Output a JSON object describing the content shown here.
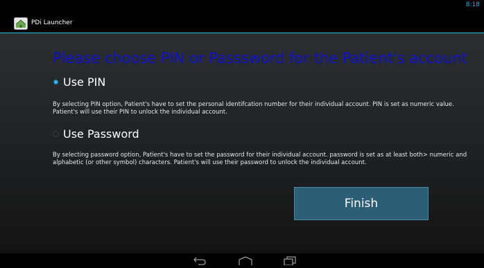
{
  "status_bar": {
    "time": "8:18"
  },
  "action_bar": {
    "title": "PDi Launcher"
  },
  "heading": "Please choose PIN or Passsword for the Patient's account",
  "options": [
    {
      "label": "Use PIN",
      "selected": true,
      "description": "By selecting PIN option, Patient's have to set the personal identifcation number for their individual account. PIN is set as numeric value. Patient's will use their PIN to unlock the individual account."
    },
    {
      "label": "Use Password",
      "selected": false,
      "description": "By selecting password option, Patient's have to set the password for their individual account. password is set as at least both> numeric and alphabetic (or other symbol) characters. Patient's will use their password to unlock the individual account."
    }
  ],
  "finish_button": {
    "label": "Finish"
  },
  "nav_bar": {
    "icons": [
      "back-icon",
      "home-icon",
      "recents-icon"
    ]
  },
  "colors": {
    "accent": "#33b5e5",
    "heading": "#1010c9",
    "button": "#2c5f76"
  }
}
